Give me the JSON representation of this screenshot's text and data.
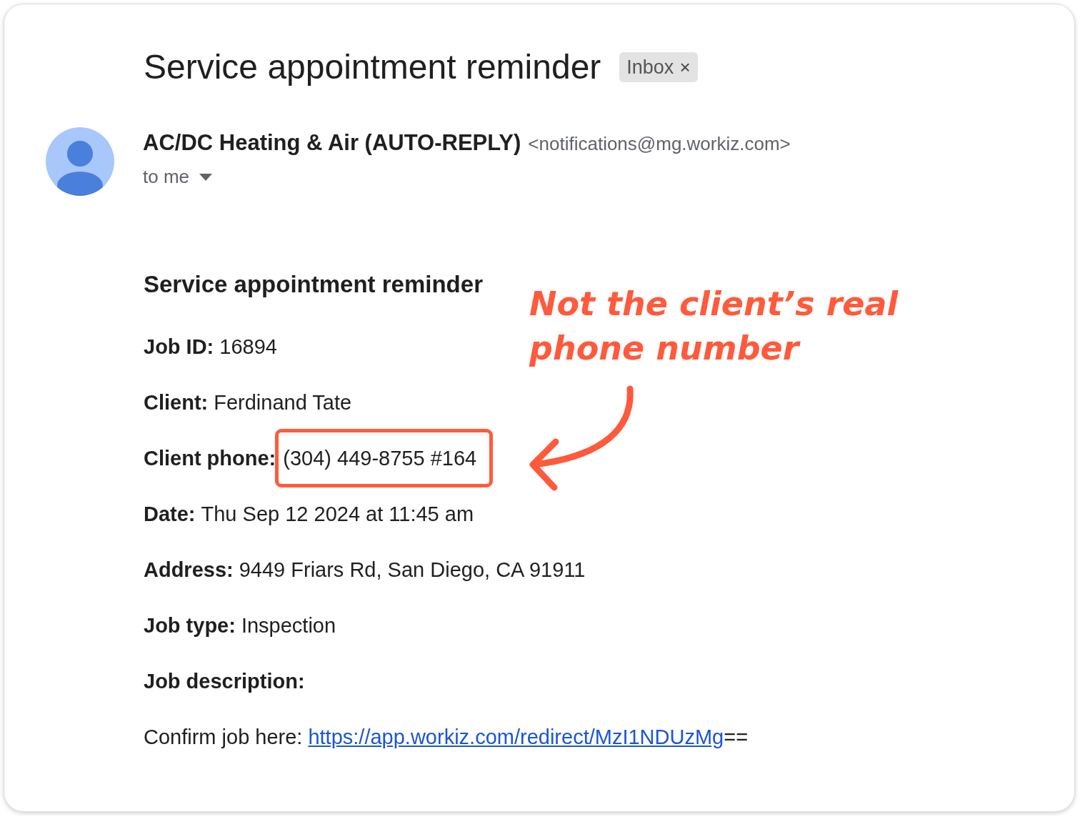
{
  "email": {
    "subject": "Service appointment reminder",
    "label": {
      "text": "Inbox",
      "close": "×"
    }
  },
  "sender": {
    "name": "AC/DC Heating & Air (AUTO-REPLY)",
    "address": "<notifications@mg.workiz.com>",
    "recipient": "to me"
  },
  "body": {
    "heading": "Service appointment reminder",
    "fields": [
      {
        "label": "Job ID:",
        "value": "16894",
        "highlighted": false
      },
      {
        "label": "Client:",
        "value": "Ferdinand Tate",
        "highlighted": false
      },
      {
        "label": "Client phone:",
        "value": "(304) 449-8755 #164",
        "highlighted": true
      },
      {
        "label": "Date:",
        "value": "Thu Sep 12 2024 at 11:45 am",
        "highlighted": false
      },
      {
        "label": "Address:",
        "value": "9449 Friars Rd, San Diego, CA 91911",
        "highlighted": false
      },
      {
        "label": "Job type:",
        "value": "Inspection",
        "highlighted": false
      },
      {
        "label": "Job description:",
        "highlighted": false
      }
    ],
    "confirm": {
      "text": "Confirm job here:",
      "link": "https://app.workiz.com/redirect/MzI1NDUzMg",
      "suffix": "=="
    }
  },
  "annotation": {
    "lines": [
      "Not the client’s real",
      "phone number"
    ]
  }
}
